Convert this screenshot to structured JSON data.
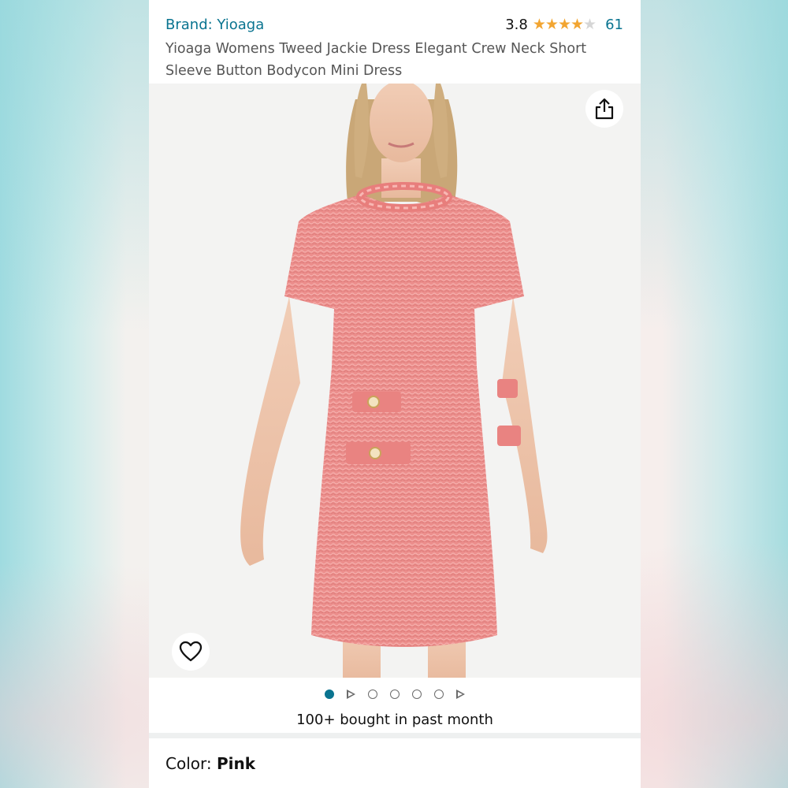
{
  "product": {
    "brand_label": "Brand: Yioaga",
    "rating_value": "3.8",
    "rating": 3.8,
    "rating_max": 5,
    "rating_count": "61",
    "title": "Yioaga Womens Tweed Jackie Dress Elegant Crew Neck Short Sleeve Button Bodycon Mini Dress"
  },
  "gallery": {
    "active_index": 0,
    "items": [
      "image",
      "video",
      "image",
      "image",
      "image",
      "image",
      "video"
    ]
  },
  "social_proof": "100+ bought in past month",
  "color": {
    "label": "Color: ",
    "value": "Pink"
  },
  "icons": {
    "share": "share-icon",
    "favorite": "heart-icon",
    "star": "star-icon"
  },
  "colors": {
    "link": "#0a7490",
    "star": "#f2a531",
    "dress": "#ec8e8c"
  }
}
